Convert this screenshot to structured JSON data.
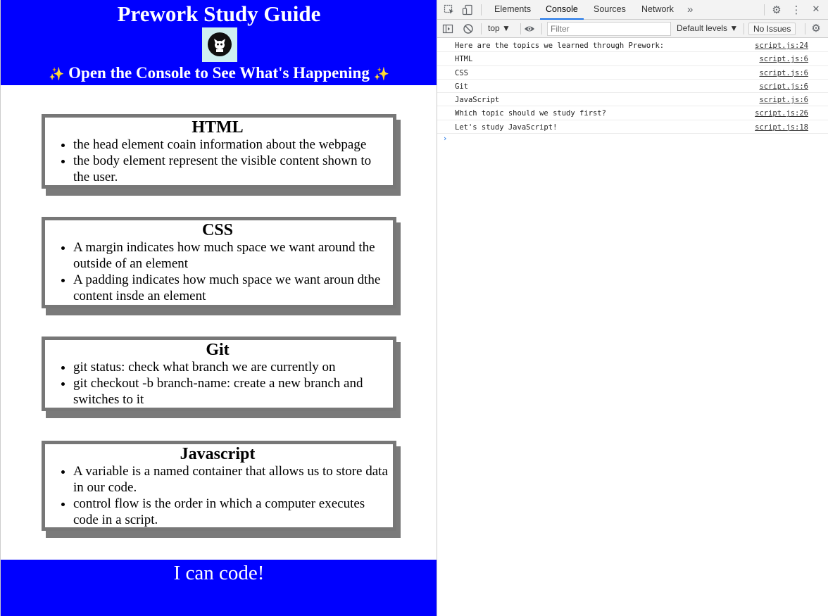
{
  "page": {
    "title": "Prework Study Guide",
    "logo_alt": "cat logo",
    "subtitle_sparkle_left": "✨",
    "subtitle": "Open the Console to See What's Happening",
    "subtitle_sparkle_right": "✨",
    "sections": [
      {
        "heading": "HTML",
        "items": [
          "the head element coain information about the webpage",
          "the body element represent the visible content shown to the user."
        ]
      },
      {
        "heading": "CSS",
        "items": [
          "A margin indicates how much space we want around the outside of an element",
          "A padding indicates how much space we want aroun dthe content insde an element"
        ]
      },
      {
        "heading": "Git",
        "items": [
          "git status: check what branch we are currently on",
          "git checkout -b branch-name: create a new branch and switches to it"
        ]
      },
      {
        "heading": "Javascript",
        "items": [
          "A variable is a named container that allows us to store data in our code.",
          "control flow is the order in which a computer executes code in a script."
        ]
      }
    ],
    "footer": "I can code!",
    "colors": {
      "header_bg": "#0000ff",
      "card_border": "#777777",
      "card_shadow": "#7a7a7a"
    }
  },
  "devtools": {
    "tabs": [
      "Elements",
      "Console",
      "Sources",
      "Network"
    ],
    "active_tab": "Console",
    "more_tabs_icon": "»",
    "context": "top ▼",
    "filter_placeholder": "Filter",
    "levels": "Default levels ▼",
    "issues": "No Issues",
    "icons": [
      "inspect-element-icon",
      "device-toolbar-icon",
      "settings-gear-icon",
      "more-vert-icon",
      "sidebar-toggle-icon",
      "clear-console-icon",
      "eye-icon"
    ],
    "console_rows": [
      {
        "message": "Here are the topics we learned through Prework:",
        "source": "script.js:24"
      },
      {
        "message": "HTML",
        "source": "script.js:6"
      },
      {
        "message": "CSS",
        "source": "script.js:6"
      },
      {
        "message": "Git",
        "source": "script.js:6"
      },
      {
        "message": "JavaScript",
        "source": "script.js:6"
      },
      {
        "message": "Which topic should we study first?",
        "source": "script.js:26"
      },
      {
        "message": "Let's study JavaScript!",
        "source": "script.js:18"
      }
    ],
    "prompt": "›"
  }
}
